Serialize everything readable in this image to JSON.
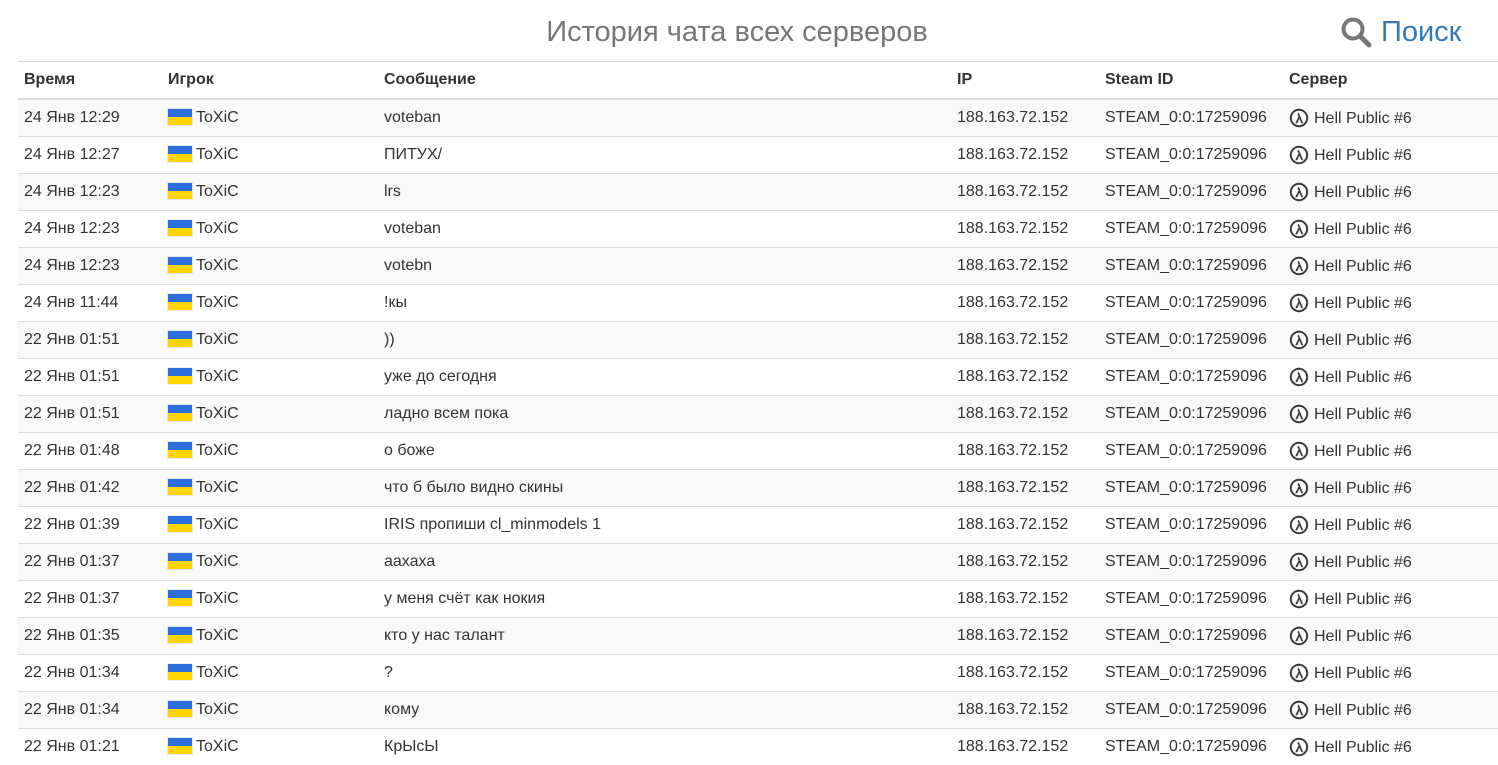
{
  "page": {
    "title": "История чата всех серверов",
    "search_label": "Поиск",
    "search_icon": "search-icon",
    "accent_color": "#337ab7"
  },
  "table": {
    "columns": [
      "Время",
      "Игрок",
      "Сообщение",
      "IP",
      "Steam ID",
      "Сервер"
    ],
    "rows": [
      {
        "time": "24 Янв 12:29",
        "player": "ToXiC",
        "flag": "ukraine-flag-icon",
        "message": "voteban",
        "ip": "188.163.72.152",
        "steam_id": "STEAM_0:0:17259096",
        "server_icon": "half-life-icon",
        "server": "Hell Public #6"
      },
      {
        "time": "24 Янв 12:27",
        "player": "ToXiC",
        "flag": "ukraine-flag-icon",
        "message": "ПИТУХ/",
        "ip": "188.163.72.152",
        "steam_id": "STEAM_0:0:17259096",
        "server_icon": "half-life-icon",
        "server": "Hell Public #6"
      },
      {
        "time": "24 Янв 12:23",
        "player": "ToXiC",
        "flag": "ukraine-flag-icon",
        "message": "lrs",
        "ip": "188.163.72.152",
        "steam_id": "STEAM_0:0:17259096",
        "server_icon": "half-life-icon",
        "server": "Hell Public #6"
      },
      {
        "time": "24 Янв 12:23",
        "player": "ToXiC",
        "flag": "ukraine-flag-icon",
        "message": "voteban",
        "ip": "188.163.72.152",
        "steam_id": "STEAM_0:0:17259096",
        "server_icon": "half-life-icon",
        "server": "Hell Public #6"
      },
      {
        "time": "24 Янв 12:23",
        "player": "ToXiC",
        "flag": "ukraine-flag-icon",
        "message": "votebn",
        "ip": "188.163.72.152",
        "steam_id": "STEAM_0:0:17259096",
        "server_icon": "half-life-icon",
        "server": "Hell Public #6"
      },
      {
        "time": "24 Янв 11:44",
        "player": "ToXiC",
        "flag": "ukraine-flag-icon",
        "message": "!кы",
        "ip": "188.163.72.152",
        "steam_id": "STEAM_0:0:17259096",
        "server_icon": "half-life-icon",
        "server": "Hell Public #6"
      },
      {
        "time": "22 Янв 01:51",
        "player": "ToXiC",
        "flag": "ukraine-flag-icon",
        "message": "))",
        "ip": "188.163.72.152",
        "steam_id": "STEAM_0:0:17259096",
        "server_icon": "half-life-icon",
        "server": "Hell Public #6"
      },
      {
        "time": "22 Янв 01:51",
        "player": "ToXiC",
        "flag": "ukraine-flag-icon",
        "message": "уже до сегодня",
        "ip": "188.163.72.152",
        "steam_id": "STEAM_0:0:17259096",
        "server_icon": "half-life-icon",
        "server": "Hell Public #6"
      },
      {
        "time": "22 Янв 01:51",
        "player": "ToXiC",
        "flag": "ukraine-flag-icon",
        "message": "ладно всем пока",
        "ip": "188.163.72.152",
        "steam_id": "STEAM_0:0:17259096",
        "server_icon": "half-life-icon",
        "server": "Hell Public #6"
      },
      {
        "time": "22 Янв 01:48",
        "player": "ToXiC",
        "flag": "ukraine-flag-icon",
        "message": "о боже",
        "ip": "188.163.72.152",
        "steam_id": "STEAM_0:0:17259096",
        "server_icon": "half-life-icon",
        "server": "Hell Public #6"
      },
      {
        "time": "22 Янв 01:42",
        "player": "ToXiC",
        "flag": "ukraine-flag-icon",
        "message": "что б было видно скины",
        "ip": "188.163.72.152",
        "steam_id": "STEAM_0:0:17259096",
        "server_icon": "half-life-icon",
        "server": "Hell Public #6"
      },
      {
        "time": "22 Янв 01:39",
        "player": "ToXiC",
        "flag": "ukraine-flag-icon",
        "message": "IRIS пропиши cl_minmodels 1",
        "ip": "188.163.72.152",
        "steam_id": "STEAM_0:0:17259096",
        "server_icon": "half-life-icon",
        "server": "Hell Public #6"
      },
      {
        "time": "22 Янв 01:37",
        "player": "ToXiC",
        "flag": "ukraine-flag-icon",
        "message": "аахаха",
        "ip": "188.163.72.152",
        "steam_id": "STEAM_0:0:17259096",
        "server_icon": "half-life-icon",
        "server": "Hell Public #6"
      },
      {
        "time": "22 Янв 01:37",
        "player": "ToXiC",
        "flag": "ukraine-flag-icon",
        "message": "у меня счёт как нокия",
        "ip": "188.163.72.152",
        "steam_id": "STEAM_0:0:17259096",
        "server_icon": "half-life-icon",
        "server": "Hell Public #6"
      },
      {
        "time": "22 Янв 01:35",
        "player": "ToXiC",
        "flag": "ukraine-flag-icon",
        "message": "кто у нас талант",
        "ip": "188.163.72.152",
        "steam_id": "STEAM_0:0:17259096",
        "server_icon": "half-life-icon",
        "server": "Hell Public #6"
      },
      {
        "time": "22 Янв 01:34",
        "player": "ToXiC",
        "flag": "ukraine-flag-icon",
        "message": "?",
        "ip": "188.163.72.152",
        "steam_id": "STEAM_0:0:17259096",
        "server_icon": "half-life-icon",
        "server": "Hell Public #6"
      },
      {
        "time": "22 Янв 01:34",
        "player": "ToXiC",
        "flag": "ukraine-flag-icon",
        "message": "кому",
        "ip": "188.163.72.152",
        "steam_id": "STEAM_0:0:17259096",
        "server_icon": "half-life-icon",
        "server": "Hell Public #6"
      },
      {
        "time": "22 Янв 01:21",
        "player": "ToXiC",
        "flag": "ukraine-flag-icon",
        "message": "КрЫсЫ",
        "ip": "188.163.72.152",
        "steam_id": "STEAM_0:0:17259096",
        "server_icon": "half-life-icon",
        "server": "Hell Public #6"
      }
    ]
  }
}
